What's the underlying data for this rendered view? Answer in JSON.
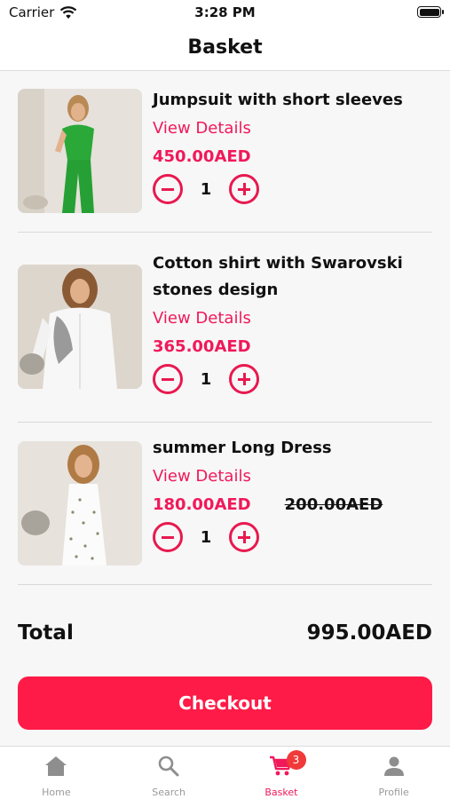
{
  "status_bar": {
    "carrier": "Carrier",
    "time": "3:28 PM"
  },
  "header": {
    "title": "Basket"
  },
  "items": [
    {
      "name_lines": [
        "Jumpsuit with short sleeves"
      ],
      "details_label": "View Details",
      "price": "450.00AED",
      "old_price": "",
      "quantity": "1"
    },
    {
      "name_lines": [
        "Cotton shirt with Swarovski",
        "stones design"
      ],
      "details_label": "View Details",
      "price": "365.00AED",
      "old_price": "",
      "quantity": "1"
    },
    {
      "name_lines": [
        "summer Long Dress"
      ],
      "details_label": "View Details",
      "price": "180.00AED",
      "old_price": "200.00AED",
      "quantity": "1"
    }
  ],
  "summary": {
    "total_label": "Total",
    "total_value": "995.00AED"
  },
  "checkout_label": "Checkout",
  "tabbar": {
    "tabs": [
      {
        "label": "Home",
        "icon": "home-icon"
      },
      {
        "label": "Search",
        "icon": "search-icon"
      },
      {
        "label": "Basket",
        "icon": "cart-icon",
        "badge": "3"
      },
      {
        "label": "Profile",
        "icon": "person-icon"
      }
    ]
  },
  "colors": {
    "accent": "#f0195a",
    "checkout": "#ff1b47",
    "badge": "#f03a3a"
  }
}
